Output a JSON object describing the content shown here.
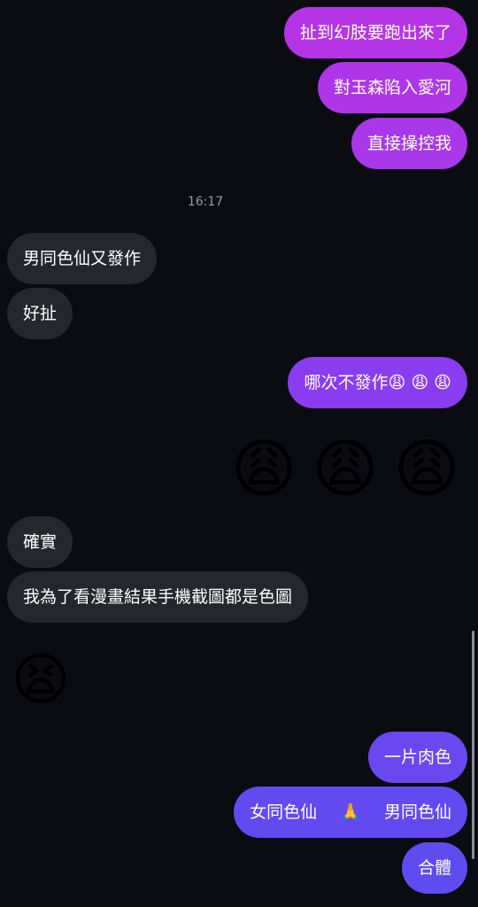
{
  "messages": {
    "m1": "扯到幻肢要跑出來了",
    "m2": "對玉森陷入愛河",
    "m3": "直接操控我",
    "timestamp": "16:17",
    "r1": "男同色仙又發作",
    "r2": "好扯",
    "m4_text": "哪次不發作",
    "m4_emoji": "😩 😩 😩",
    "big_emoji_1": "😩",
    "big_emoji_2": "😩",
    "big_emoji_3": "😩",
    "r3": "確實",
    "r4": "我為了看漫畫結果手機截圖都是色圖",
    "r5_emoji": "😫",
    "m5": "一片肉色",
    "m6_left": "女同色仙",
    "m6_emoji": "🙏",
    "m6_right": "男同色仙",
    "m7": "合體"
  },
  "colors": {
    "background": "#0b0b12",
    "incoming_bubble": "#26272c",
    "outgoing_top": "#b535e6",
    "outgoing_mid": "#8a3cf0",
    "outgoing_bottom": "#5f4cf0"
  },
  "icons": {
    "weary_face": "weary-face-icon",
    "tired_face": "tired-face-icon",
    "folded_hands": "folded-hands-icon"
  }
}
